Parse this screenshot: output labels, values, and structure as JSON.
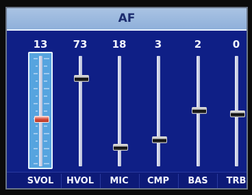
{
  "title": "AF",
  "sliders": [
    {
      "label": "SVOL",
      "value": "13",
      "level": 0.43,
      "selected": true
    },
    {
      "label": "HVOL",
      "value": "73",
      "level": 0.8,
      "selected": false
    },
    {
      "label": "MIC",
      "value": "18",
      "level": 0.18,
      "selected": false
    },
    {
      "label": "CMP",
      "value": "3",
      "level": 0.25,
      "selected": false
    },
    {
      "label": "BAS",
      "value": "2",
      "level": 0.51,
      "selected": false
    },
    {
      "label": "TRB",
      "value": "0",
      "level": 0.48,
      "selected": false
    }
  ],
  "colors": {
    "background": "#0f1f86",
    "title_bar": "#9bb9df",
    "selection": "#56a4df",
    "selected_knob": "#d8503e"
  }
}
